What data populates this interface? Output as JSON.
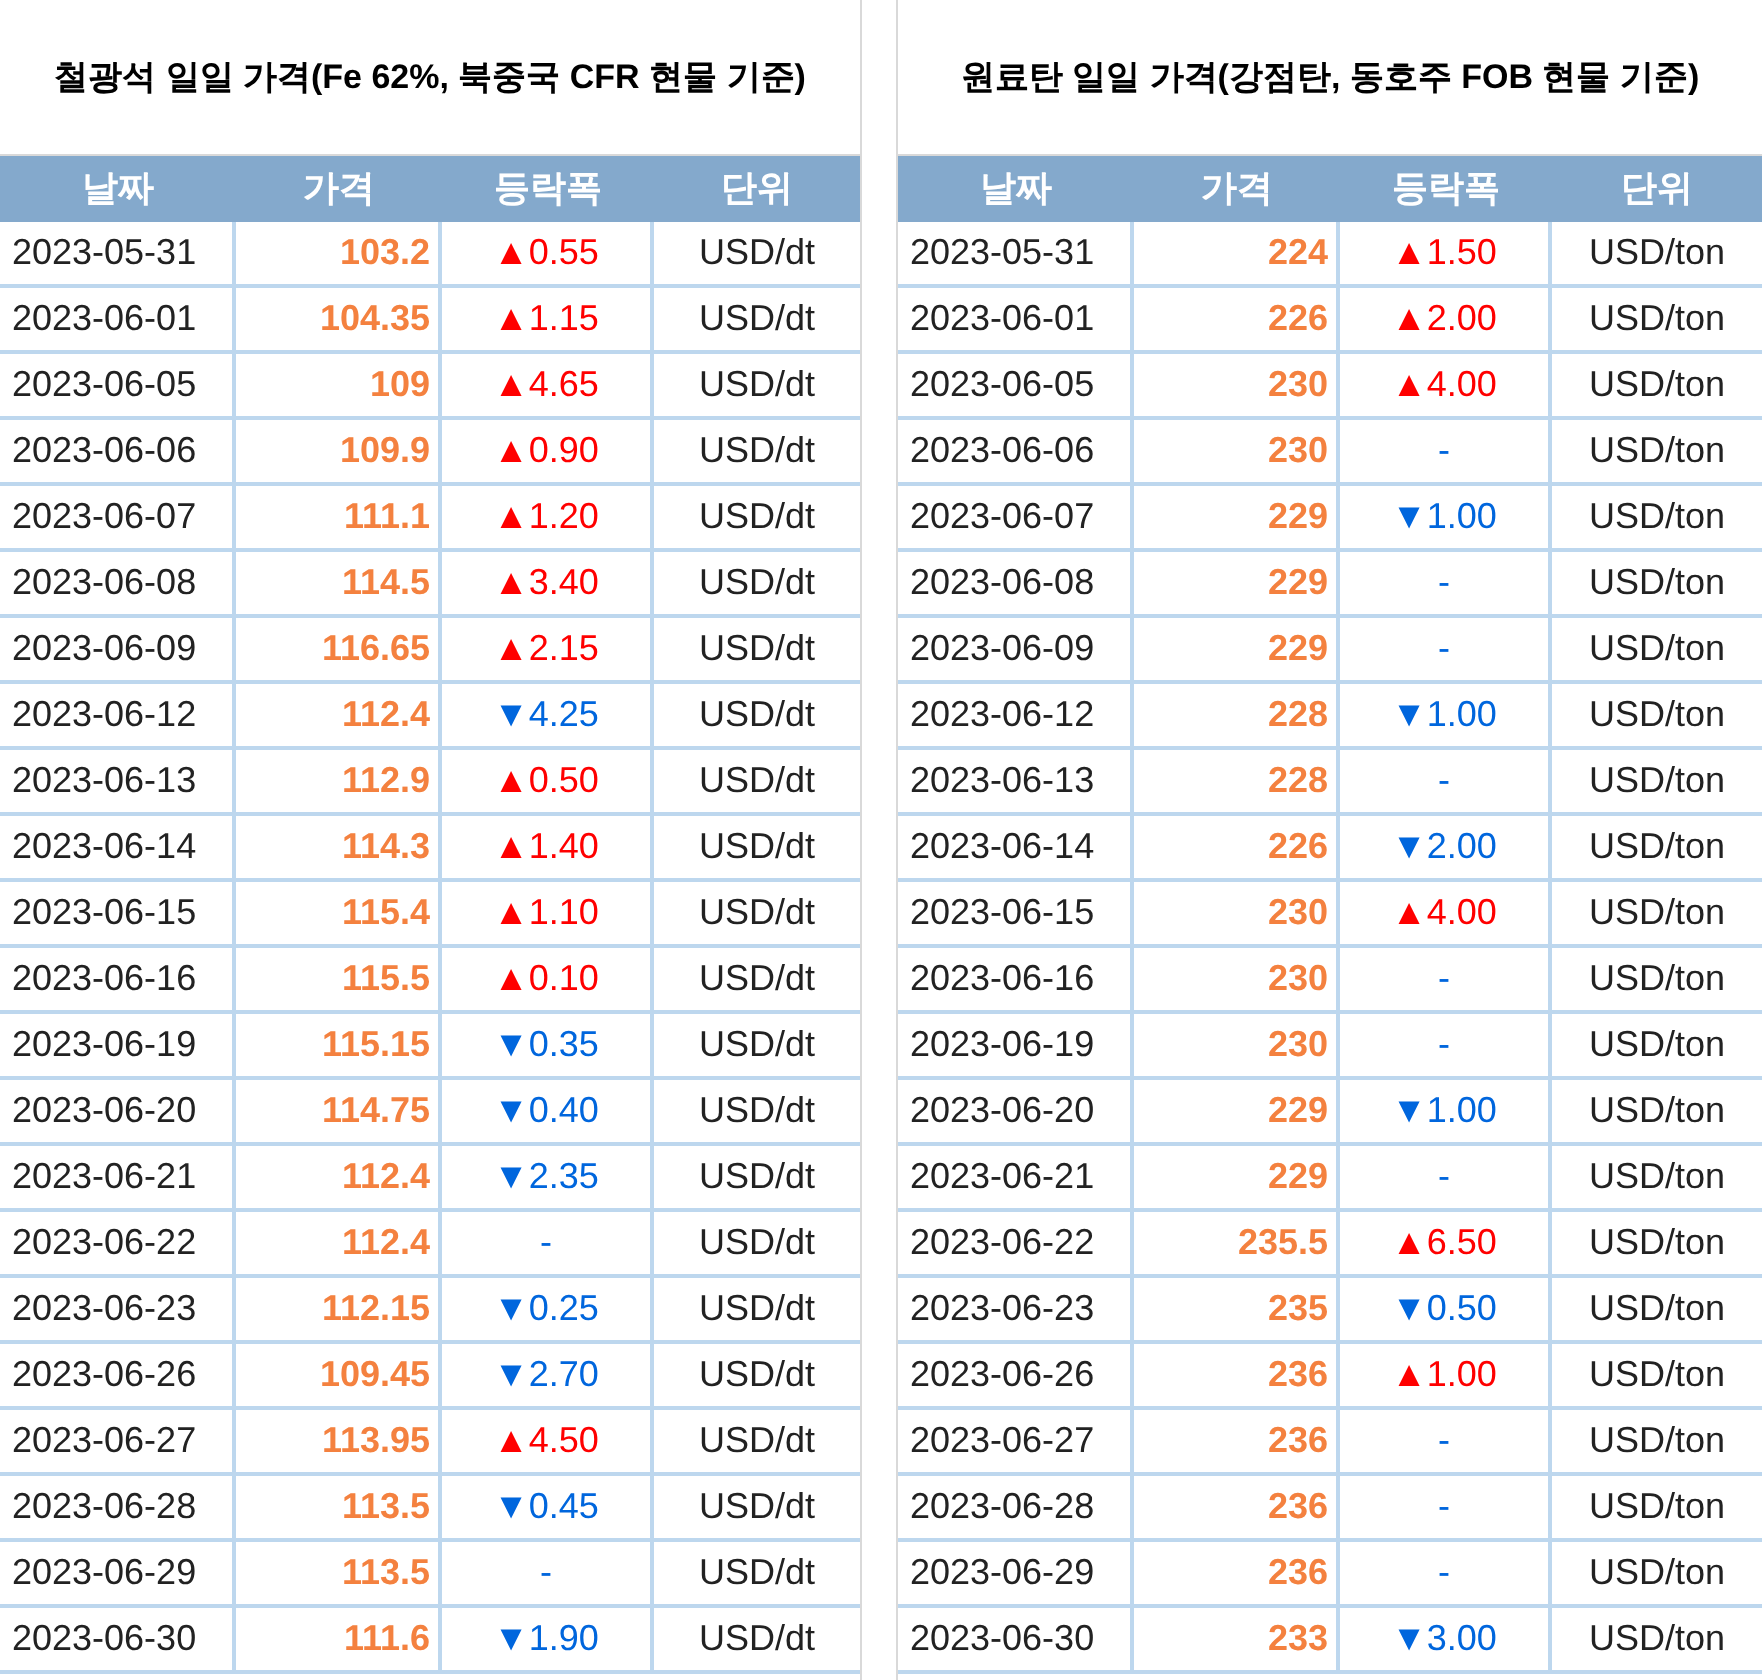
{
  "tables": [
    {
      "title": "철광석 일일 가격(Fe 62%, 북중국 CFR 현물 기준)",
      "columns": [
        "날짜",
        "가격",
        "등락폭",
        "단위"
      ],
      "rows": [
        {
          "date": "2023-05-31",
          "price": "103.2",
          "change": {
            "kind": "up",
            "text": "▲0.55"
          },
          "unit": "USD/dt"
        },
        {
          "date": "2023-06-01",
          "price": "104.35",
          "change": {
            "kind": "up",
            "text": "▲1.15"
          },
          "unit": "USD/dt"
        },
        {
          "date": "2023-06-05",
          "price": "109",
          "change": {
            "kind": "up",
            "text": "▲4.65"
          },
          "unit": "USD/dt"
        },
        {
          "date": "2023-06-06",
          "price": "109.9",
          "change": {
            "kind": "up",
            "text": "▲0.90"
          },
          "unit": "USD/dt"
        },
        {
          "date": "2023-06-07",
          "price": "111.1",
          "change": {
            "kind": "up",
            "text": "▲1.20"
          },
          "unit": "USD/dt"
        },
        {
          "date": "2023-06-08",
          "price": "114.5",
          "change": {
            "kind": "up",
            "text": "▲3.40"
          },
          "unit": "USD/dt"
        },
        {
          "date": "2023-06-09",
          "price": "116.65",
          "change": {
            "kind": "up",
            "text": "▲2.15"
          },
          "unit": "USD/dt"
        },
        {
          "date": "2023-06-12",
          "price": "112.4",
          "change": {
            "kind": "down",
            "text": "▼4.25"
          },
          "unit": "USD/dt"
        },
        {
          "date": "2023-06-13",
          "price": "112.9",
          "change": {
            "kind": "up",
            "text": "▲0.50"
          },
          "unit": "USD/dt"
        },
        {
          "date": "2023-06-14",
          "price": "114.3",
          "change": {
            "kind": "up",
            "text": "▲1.40"
          },
          "unit": "USD/dt"
        },
        {
          "date": "2023-06-15",
          "price": "115.4",
          "change": {
            "kind": "up",
            "text": "▲1.10"
          },
          "unit": "USD/dt"
        },
        {
          "date": "2023-06-16",
          "price": "115.5",
          "change": {
            "kind": "up",
            "text": "▲0.10"
          },
          "unit": "USD/dt"
        },
        {
          "date": "2023-06-19",
          "price": "115.15",
          "change": {
            "kind": "down",
            "text": "▼0.35"
          },
          "unit": "USD/dt"
        },
        {
          "date": "2023-06-20",
          "price": "114.75",
          "change": {
            "kind": "down",
            "text": "▼0.40"
          },
          "unit": "USD/dt"
        },
        {
          "date": "2023-06-21",
          "price": "112.4",
          "change": {
            "kind": "down",
            "text": "▼2.35"
          },
          "unit": "USD/dt"
        },
        {
          "date": "2023-06-22",
          "price": "112.4",
          "change": {
            "kind": "flat",
            "text": "-"
          },
          "unit": "USD/dt"
        },
        {
          "date": "2023-06-23",
          "price": "112.15",
          "change": {
            "kind": "down",
            "text": "▼0.25"
          },
          "unit": "USD/dt"
        },
        {
          "date": "2023-06-26",
          "price": "109.45",
          "change": {
            "kind": "down",
            "text": "▼2.70"
          },
          "unit": "USD/dt"
        },
        {
          "date": "2023-06-27",
          "price": "113.95",
          "change": {
            "kind": "up",
            "text": "▲4.50"
          },
          "unit": "USD/dt"
        },
        {
          "date": "2023-06-28",
          "price": "113.5",
          "change": {
            "kind": "down",
            "text": "▼0.45"
          },
          "unit": "USD/dt"
        },
        {
          "date": "2023-06-29",
          "price": "113.5",
          "change": {
            "kind": "flat",
            "text": "-"
          },
          "unit": "USD/dt"
        },
        {
          "date": "2023-06-30",
          "price": "111.6",
          "change": {
            "kind": "down",
            "text": "▼1.90"
          },
          "unit": "USD/dt"
        }
      ]
    },
    {
      "title": "원료탄 일일 가격(강점탄, 동호주 FOB 현물 기준)",
      "columns": [
        "날짜",
        "가격",
        "등락폭",
        "단위"
      ],
      "rows": [
        {
          "date": "2023-05-31",
          "price": "224",
          "change": {
            "kind": "up",
            "text": "▲1.50"
          },
          "unit": "USD/ton"
        },
        {
          "date": "2023-06-01",
          "price": "226",
          "change": {
            "kind": "up",
            "text": "▲2.00"
          },
          "unit": "USD/ton"
        },
        {
          "date": "2023-06-05",
          "price": "230",
          "change": {
            "kind": "up",
            "text": "▲4.00"
          },
          "unit": "USD/ton"
        },
        {
          "date": "2023-06-06",
          "price": "230",
          "change": {
            "kind": "flat",
            "text": "-"
          },
          "unit": "USD/ton"
        },
        {
          "date": "2023-06-07",
          "price": "229",
          "change": {
            "kind": "down",
            "text": "▼1.00"
          },
          "unit": "USD/ton"
        },
        {
          "date": "2023-06-08",
          "price": "229",
          "change": {
            "kind": "flat",
            "text": "-"
          },
          "unit": "USD/ton"
        },
        {
          "date": "2023-06-09",
          "price": "229",
          "change": {
            "kind": "flat",
            "text": "-"
          },
          "unit": "USD/ton"
        },
        {
          "date": "2023-06-12",
          "price": "228",
          "change": {
            "kind": "down",
            "text": "▼1.00"
          },
          "unit": "USD/ton"
        },
        {
          "date": "2023-06-13",
          "price": "228",
          "change": {
            "kind": "flat",
            "text": "-"
          },
          "unit": "USD/ton"
        },
        {
          "date": "2023-06-14",
          "price": "226",
          "change": {
            "kind": "down",
            "text": "▼2.00"
          },
          "unit": "USD/ton"
        },
        {
          "date": "2023-06-15",
          "price": "230",
          "change": {
            "kind": "up",
            "text": "▲4.00"
          },
          "unit": "USD/ton"
        },
        {
          "date": "2023-06-16",
          "price": "230",
          "change": {
            "kind": "flat",
            "text": "-"
          },
          "unit": "USD/ton"
        },
        {
          "date": "2023-06-19",
          "price": "230",
          "change": {
            "kind": "flat",
            "text": "-"
          },
          "unit": "USD/ton"
        },
        {
          "date": "2023-06-20",
          "price": "229",
          "change": {
            "kind": "down",
            "text": "▼1.00"
          },
          "unit": "USD/ton"
        },
        {
          "date": "2023-06-21",
          "price": "229",
          "change": {
            "kind": "flat",
            "text": "-"
          },
          "unit": "USD/ton"
        },
        {
          "date": "2023-06-22",
          "price": "235.5",
          "change": {
            "kind": "up",
            "text": "▲6.50"
          },
          "unit": "USD/ton"
        },
        {
          "date": "2023-06-23",
          "price": "235",
          "change": {
            "kind": "down",
            "text": "▼0.50"
          },
          "unit": "USD/ton"
        },
        {
          "date": "2023-06-26",
          "price": "236",
          "change": {
            "kind": "up",
            "text": "▲1.00"
          },
          "unit": "USD/ton"
        },
        {
          "date": "2023-06-27",
          "price": "236",
          "change": {
            "kind": "flat",
            "text": "-"
          },
          "unit": "USD/ton"
        },
        {
          "date": "2023-06-28",
          "price": "236",
          "change": {
            "kind": "flat",
            "text": "-"
          },
          "unit": "USD/ton"
        },
        {
          "date": "2023-06-29",
          "price": "236",
          "change": {
            "kind": "flat",
            "text": "-"
          },
          "unit": "USD/ton"
        },
        {
          "date": "2023-06-30",
          "price": "233",
          "change": {
            "kind": "down",
            "text": "▼3.00"
          },
          "unit": "USD/ton"
        }
      ]
    }
  ]
}
